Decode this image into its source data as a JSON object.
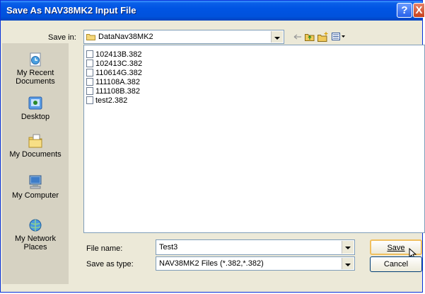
{
  "window": {
    "title": "Save As NAV38MK2 Input File",
    "help_symbol": "?",
    "close_symbol": "X"
  },
  "save_in": {
    "label": "Save in:",
    "value": "DataNav38MK2"
  },
  "places": [
    {
      "label": "My Recent\nDocuments",
      "icon": "recent-documents-icon"
    },
    {
      "label": "Desktop",
      "icon": "desktop-icon"
    },
    {
      "label": "My Documents",
      "icon": "my-documents-icon"
    },
    {
      "label": "My Computer",
      "icon": "my-computer-icon"
    },
    {
      "label": "My Network\nPlaces",
      "icon": "network-places-icon"
    }
  ],
  "files": [
    "102413B.382",
    "102413C.382",
    "110614G.382",
    "111108A.382",
    "111108B.382",
    "test2.382"
  ],
  "file_name": {
    "label": "File name:",
    "value": "Test3"
  },
  "save_as_type": {
    "label": "Save as type:",
    "value": "NAV38MK2 Files (*.382,*.382)"
  },
  "buttons": {
    "save": "Save",
    "cancel": "Cancel"
  }
}
